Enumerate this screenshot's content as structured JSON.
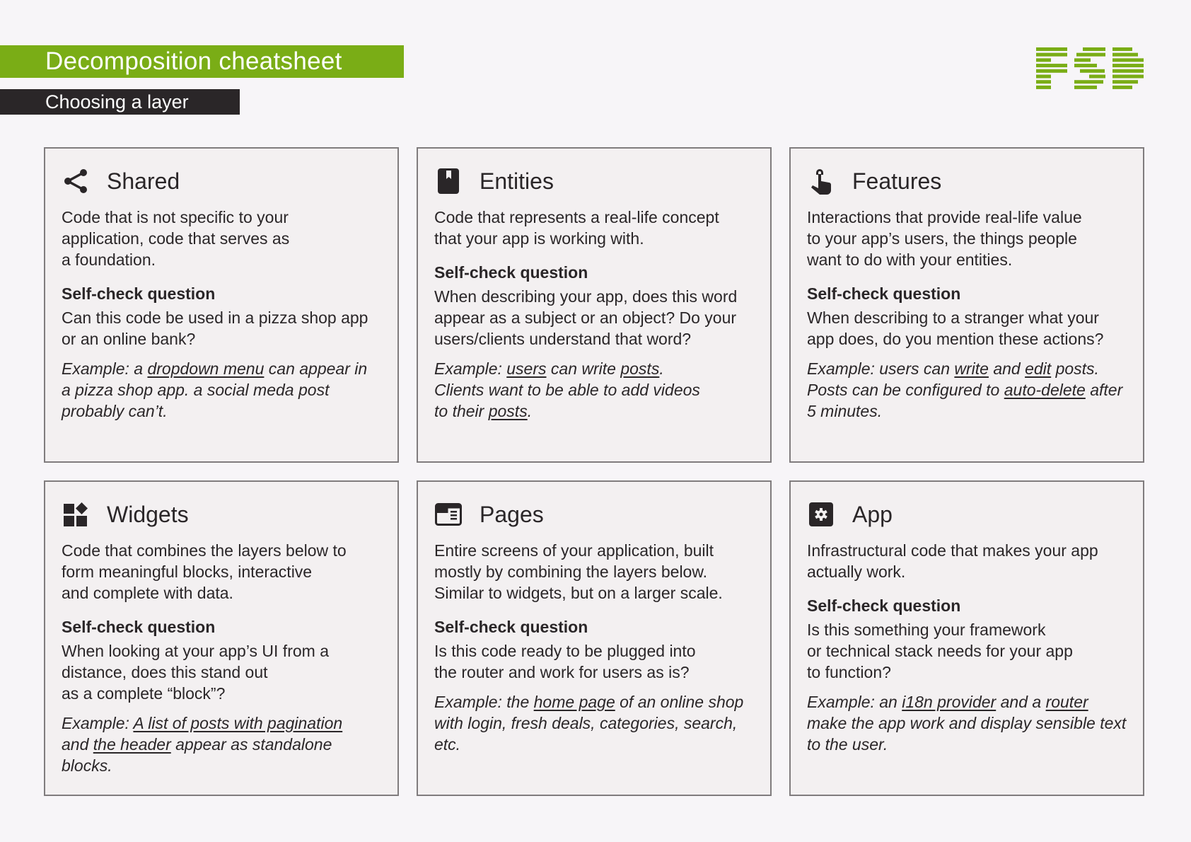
{
  "header": {
    "title": "Decomposition cheatsheet",
    "subtitle": "Choosing a layer",
    "logo_text": "FSD",
    "accent_color": "#7aad16",
    "dark_color": "#2a2628"
  },
  "question_label": "Self-check question",
  "cards": [
    {
      "title": "Shared",
      "icon": "share-icon",
      "description": "Code that is not specific to your\napplication, code that serves as\na foundation.",
      "question": "Can this code be used in a pizza shop app\nor an online bank?",
      "example": [
        {
          "t": "Example: a "
        },
        {
          "t": "dropdown menu",
          "u": true
        },
        {
          "t": " can appear in\na pizza shop app. a social meda post\nprobably can’t."
        }
      ]
    },
    {
      "title": "Entities",
      "icon": "bookmark-book-icon",
      "description": "Code that represents a real-life concept\nthat your app is working with.",
      "question": "When describing your app, does this word\nappear as a subject or an object? Do your\nusers/clients understand that word?",
      "example": [
        {
          "t": "Example: "
        },
        {
          "t": "users",
          "u": true
        },
        {
          "t": " can write "
        },
        {
          "t": "posts",
          "u": true
        },
        {
          "t": ".\nClients want to be able to add videos\nto their "
        },
        {
          "t": "posts",
          "u": true
        },
        {
          "t": "."
        }
      ]
    },
    {
      "title": "Features",
      "icon": "pointing-hand-icon",
      "description": "Interactions that provide real-life value\nto your app’s users, the things people\nwant to do with your entities.",
      "question": "When describing to a stranger what your\napp does, do you mention these actions?",
      "example": [
        {
          "t": "Example: users can "
        },
        {
          "t": "write",
          "u": true
        },
        {
          "t": " and "
        },
        {
          "t": "edit",
          "u": true
        },
        {
          "t": " posts.\nPosts can be configured to "
        },
        {
          "t": "auto-delete",
          "u": true
        },
        {
          "t": " after\n5 minutes."
        }
      ]
    },
    {
      "title": "Widgets",
      "icon": "widgets-icon",
      "description": "Code that combines the layers below to\nform meaningful blocks, interactive\nand complete with data.",
      "question": "When looking at your app’s UI from a\ndistance, does this stand out\nas a complete “block”?",
      "example": [
        {
          "t": "Example: "
        },
        {
          "t": "A list of posts with pagination",
          "u": true
        },
        {
          "t": "\nand "
        },
        {
          "t": "the header",
          "u": true
        },
        {
          "t": " appear as standalone\nblocks."
        }
      ]
    },
    {
      "title": "Pages",
      "icon": "web-page-icon",
      "description": "Entire screens of your application, built\nmostly by combining the layers below.\nSimilar to widgets, but on a larger scale.",
      "question": "Is this code ready to be plugged into\nthe router and work for users as is?",
      "example": [
        {
          "t": "Example: the "
        },
        {
          "t": "home page",
          "u": true
        },
        {
          "t": " of an online shop\nwith login, fresh deals, categories, search,\netc."
        }
      ]
    },
    {
      "title": "App",
      "icon": "gear-icon",
      "description": "Infrastructural code that makes your app\nactually work.",
      "question": "Is this something your framework\nor technical stack needs for your app\nto function?",
      "example": [
        {
          "t": "Example: an "
        },
        {
          "t": "i18n provider",
          "u": true
        },
        {
          "t": " and a "
        },
        {
          "t": "router",
          "u": true
        },
        {
          "t": "\nmake the app work and display sensible text\nto the user."
        }
      ]
    }
  ]
}
